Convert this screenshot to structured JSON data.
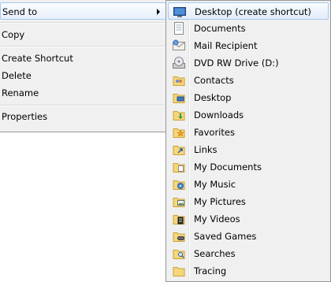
{
  "context_menu": {
    "items": [
      {
        "label": "Send to"
      },
      {
        "label": "Copy"
      },
      {
        "label": "Create Shortcut"
      },
      {
        "label": "Delete"
      },
      {
        "label": "Rename"
      },
      {
        "label": "Properties"
      }
    ]
  },
  "submenu": {
    "items": [
      {
        "label": "Desktop (create shortcut)",
        "icon": "desktop-shortcut-icon"
      },
      {
        "label": "Documents",
        "icon": "documents-icon"
      },
      {
        "label": "Mail Recipient",
        "icon": "mail-recipient-icon"
      },
      {
        "label": "DVD RW Drive (D:)",
        "icon": "dvd-drive-icon"
      },
      {
        "label": "Contacts",
        "icon": "contacts-folder-icon"
      },
      {
        "label": "Desktop",
        "icon": "desktop-folder-icon"
      },
      {
        "label": "Downloads",
        "icon": "downloads-folder-icon"
      },
      {
        "label": "Favorites",
        "icon": "favorites-folder-icon"
      },
      {
        "label": "Links",
        "icon": "links-folder-icon"
      },
      {
        "label": "My Documents",
        "icon": "my-documents-folder-icon"
      },
      {
        "label": "My Music",
        "icon": "my-music-folder-icon"
      },
      {
        "label": "My Pictures",
        "icon": "my-pictures-folder-icon"
      },
      {
        "label": "My Videos",
        "icon": "my-videos-folder-icon"
      },
      {
        "label": "Saved Games",
        "icon": "saved-games-folder-icon"
      },
      {
        "label": "Searches",
        "icon": "searches-folder-icon"
      },
      {
        "label": "Tracing",
        "icon": "tracing-folder-icon"
      }
    ]
  }
}
